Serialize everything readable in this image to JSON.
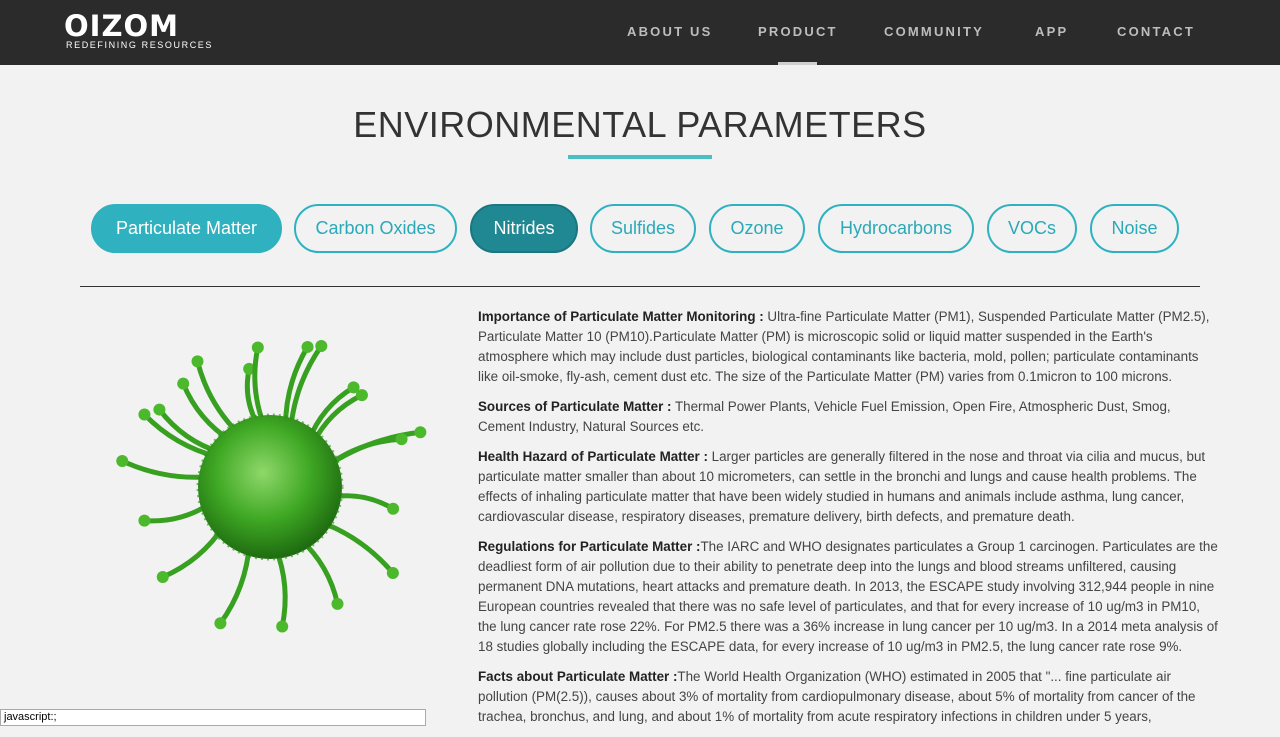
{
  "brand": {
    "name": "OIZOM",
    "tagline": "REDEFINING RESOURCES"
  },
  "nav": {
    "items": [
      "ABOUT US",
      "PRODUCT",
      "COMMUNITY",
      "APP",
      "CONTACT"
    ],
    "active": "PRODUCT"
  },
  "page": {
    "title": "ENVIRONMENTAL PARAMETERS"
  },
  "tabs": {
    "items": [
      "Particulate Matter",
      "Carbon Oxides",
      "Nitrides",
      "Sulfides",
      "Ozone",
      "Hydrocarbons",
      "VOCs",
      "Noise"
    ],
    "selected": "Particulate Matter",
    "hovered": "Nitrides"
  },
  "content": {
    "sections": [
      {
        "heading": "Importance of Particulate Matter Monitoring :",
        "text": " Ultra-fine Particulate Matter (PM1), Suspended Particulate Matter (PM2.5), Particulate Matter 10 (PM10).Particulate Matter (PM) is microscopic solid or liquid matter suspended in the Earth's atmosphere which may include dust particles, biological contaminants like bacteria, mold, pollen; particulate contaminants like oil-smoke, fly-ash, cement dust etc. The size of the Particulate Matter (PM) varies from 0.1micron to 100 microns."
      },
      {
        "heading": "Sources of Particulate Matter :",
        "text": " Thermal Power Plants, Vehicle Fuel Emission, Open Fire, Atmospheric Dust, Smog, Cement Industry, Natural Sources etc."
      },
      {
        "heading": "Health Hazard of Particulate Matter :",
        "text": " Larger particles are generally filtered in the nose and throat via cilia and mucus, but particulate matter smaller than about 10 micrometers, can settle in the bronchi and lungs and cause health problems. The effects of inhaling particulate matter that have been widely studied in humans and animals include asthma, lung cancer, cardiovascular disease, respiratory diseases, premature delivery, birth defects, and premature death."
      },
      {
        "heading": "Regulations for Particulate Matter :",
        "text": "The IARC and WHO designates particulates a Group 1 carcinogen. Particulates are the deadliest form of air pollution due to their ability to penetrate deep into the lungs and blood streams unfiltered, causing permanent DNA mutations, heart attacks and premature death. In 2013, the ESCAPE study involving 312,944 people in nine European countries revealed that there was no safe level of particulates, and that for every increase of 10 ug/m3 in PM10, the lung cancer rate rose 22%. For PM2.5 there was a 36% increase in lung cancer per 10 ug/m3. In a 2014 meta analysis of 18 studies globally including the ESCAPE data, for every increase of 10 ug/m3 in PM2.5, the lung cancer rate rose 9%."
      },
      {
        "heading": "Facts about Particulate Matter :",
        "text": "The World Health Organization (WHO) estimated in 2005 that \"... fine particulate air pollution (PM(2.5)), causes about 3% of mortality from cardiopulmonary disease, about 5% of mortality from cancer of the trachea, bronchus, and lung, and about 1% of mortality from acute respiratory infections in children under 5 years,"
      }
    ]
  },
  "image": {
    "icon": "virus-icon"
  },
  "status": {
    "text": "javascript:;"
  },
  "colors": {
    "accent": "#2fb1bf",
    "nav_bg": "#2b2b2b",
    "virus": "#3fa824"
  }
}
